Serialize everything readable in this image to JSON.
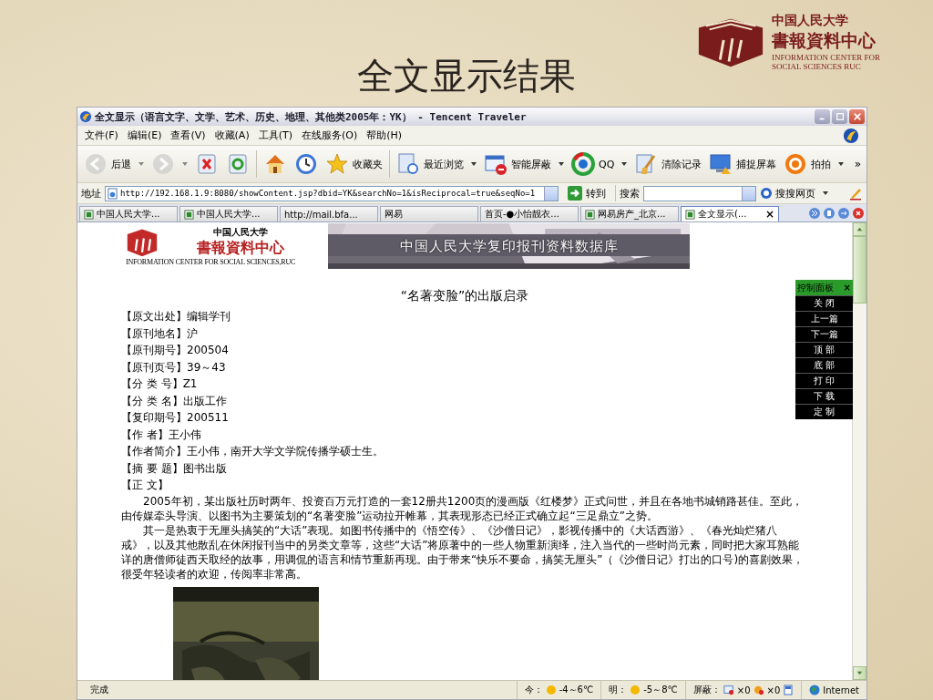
{
  "slide": {
    "title": "全文显示结果",
    "logo": {
      "line1": "中国人民大学",
      "line2": "書報資料中心",
      "line3": "INFORMATION CENTER FOR",
      "line4": "SOCIAL SCIENCES RUC"
    }
  },
  "browser": {
    "title": "全文显示（语言文字、文学、艺术、历史、地理、其他类2005年：YK） - Tencent Traveler",
    "menu": [
      "文件(F)",
      "编辑(E)",
      "查看(V)",
      "收藏(A)",
      "工具(T)",
      "在线服务(O)",
      "帮助(H)"
    ],
    "toolbar": [
      {
        "kind": "back",
        "label": "后退",
        "dropdown": true,
        "disabled": true
      },
      {
        "kind": "forward",
        "dropdown": true,
        "disabled": true
      },
      {
        "kind": "stop",
        "dropdown": false,
        "disabled": false
      },
      {
        "kind": "refresh",
        "dropdown": false,
        "disabled": false
      },
      {
        "kind": "home",
        "dropdown": false,
        "disabled": false
      },
      {
        "kind": "history",
        "dropdown": false,
        "disabled": false
      },
      {
        "kind": "favorites",
        "label": "收藏夹",
        "dropdown": false,
        "disabled": false
      },
      {
        "kind": "recent",
        "label": "最近浏览",
        "dropdown": true,
        "disabled": false
      },
      {
        "kind": "block",
        "label": "智能屏蔽",
        "dropdown": true,
        "disabled": false
      },
      {
        "kind": "qq",
        "label": "QQ",
        "dropdown": true,
        "disabled": false
      },
      {
        "kind": "clear",
        "label": "清除记录",
        "dropdown": false,
        "disabled": false
      },
      {
        "kind": "capture",
        "label": "捕捉屏幕",
        "dropdown": false,
        "disabled": false
      },
      {
        "kind": "paipai",
        "label": "拍拍",
        "dropdown": true,
        "disabled": false
      }
    ],
    "toolbar_more": "»",
    "address": {
      "label": "地址",
      "value": "http://192.168.1.9:8080/showContent.jsp?dbid=YK&searchNo=1&isReciprocal=true&seqNo=1",
      "go": "转到"
    },
    "search": {
      "label": "搜索",
      "button": "搜搜网页"
    },
    "tabs": [
      {
        "label": "中国人民大学...",
        "icon": true,
        "selected": false
      },
      {
        "label": "中国人民大学...",
        "icon": true,
        "selected": false
      },
      {
        "label": "http://mail.bfa...",
        "icon": false,
        "selected": false
      },
      {
        "label": "网易",
        "icon": false,
        "selected": false
      },
      {
        "label": "首页-●小怡靓衣...",
        "icon": false,
        "selected": false
      },
      {
        "label": "网易房产_北京...",
        "icon": true,
        "selected": false
      },
      {
        "label": "全文显示(...",
        "icon": true,
        "selected": true
      }
    ],
    "tab_close": "×",
    "page": {
      "logo": {
        "line1": "中国人民大学",
        "line2": "書報資料中心",
        "line3": "INFORMATION CENTER FOR SOCIAL SCIENCES,RUC"
      },
      "banner": "中国人民大学复印报刊资料数据库",
      "heading": "“名著变脸”的出版启录",
      "fields": [
        {
          "label": "【原文出处】",
          "value": "编辑学刊"
        },
        {
          "label": "【原刊地名】",
          "value": "沪"
        },
        {
          "label": "【原刊期号】",
          "value": "200504"
        },
        {
          "label": "【原刊页号】",
          "value": "39～43"
        },
        {
          "label": "【分 类 号】",
          "value": "Z1"
        },
        {
          "label": "【分 类 名】",
          "value": "出版工作"
        },
        {
          "label": "【复印期号】",
          "value": "200511"
        },
        {
          "label": "【作 者】",
          "value": "王小伟"
        },
        {
          "label": "【作者简介】",
          "value": "王小伟，南开大学文学院传播学硕士生。"
        },
        {
          "label": "【摘 要 题】",
          "value": "图书出版"
        },
        {
          "label": "【正 文】"
        }
      ],
      "paragraphs": [
        "2005年初，某出版社历时两年、投资百万元打造的一套12册共1200页的漫画版《红楼梦》正式问世，并且在各地书城销路甚佳。至此，由传媒牵头导演、以图书为主要策划的“名著变脸”运动拉开帷幕，其表现形态已经正式确立起“三足鼎立”之势。",
        "其一是热衷于无厘头搞笑的“大话”表现。如图书传播中的《悟空传》、《沙僧日记》，影视传播中的《大话西游》、《春光灿烂猪八戒》，以及其他散乱在休闲报刊当中的另类文章等，这些“大话”将原著中的一些人物重新演绎，注入当代的一些时尚元素，同时把大家耳熟能详的唐僧师徒西天取经的故事，用调侃的语言和情节重新再现。由于带来“快乐不要命，搞笑无厘头”（《沙僧日记》打出的口号)的喜剧效果，很受年轻读者的欢迎，传阅率非常高。"
      ]
    },
    "control_panel": {
      "title": "控制面板",
      "close": "×",
      "buttons": [
        "关 闭",
        "上一篇",
        "下一篇",
        "顶 部",
        "底 部",
        "打 印",
        "下 载",
        "定 制"
      ]
    },
    "status": {
      "text": "完成",
      "today_label": "今：",
      "today": "-4～6℃",
      "tomorrow_label": "明：",
      "tomorrow": "-5～8℃",
      "block_label": "屏蔽：",
      "popups": "×0",
      "ads": "×0",
      "zone": "Internet"
    }
  }
}
